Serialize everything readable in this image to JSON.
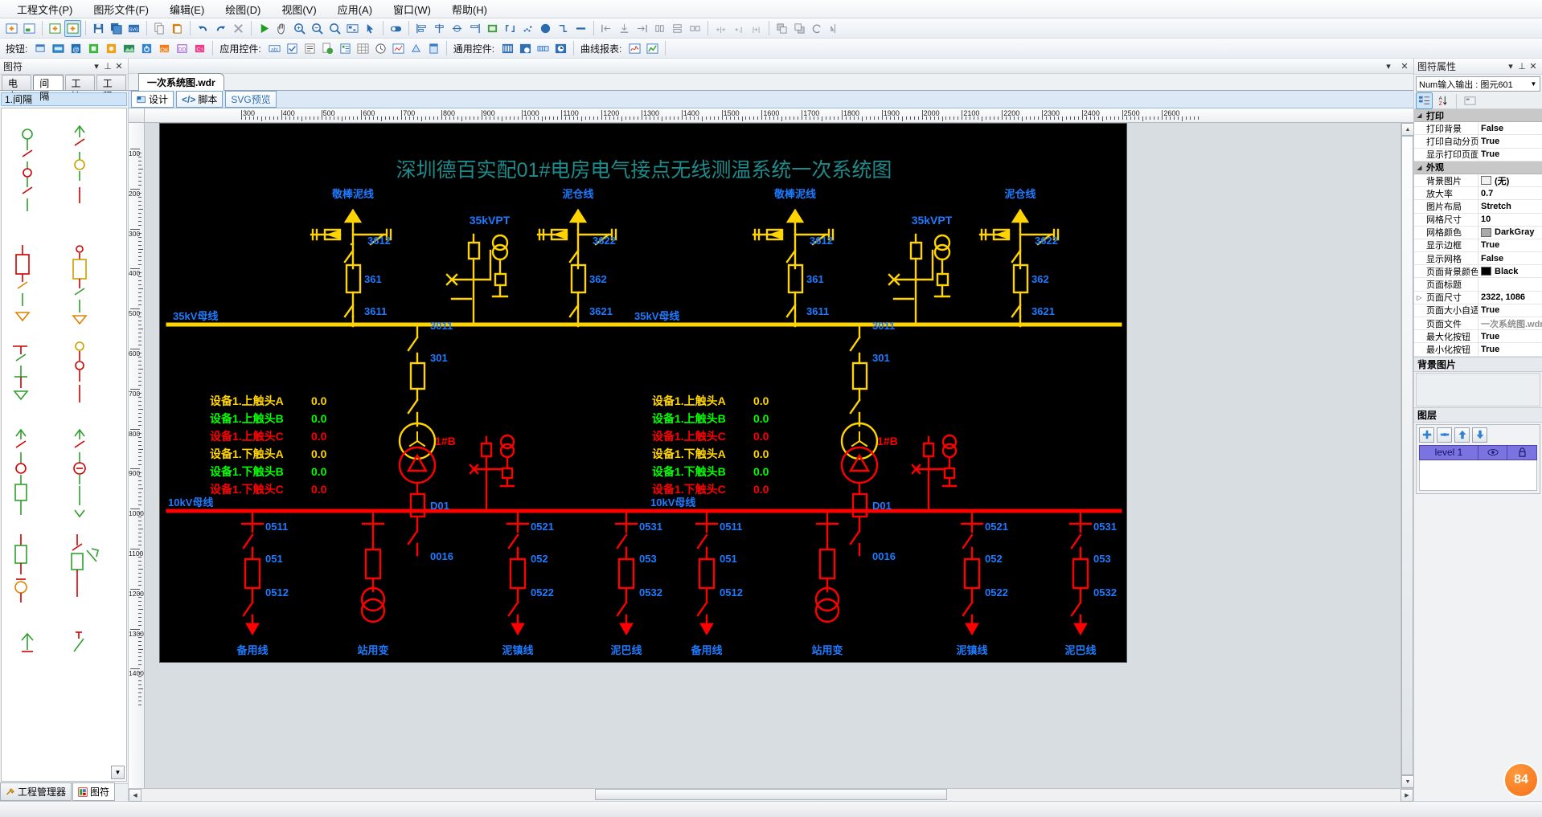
{
  "menu": {
    "items": [
      "工程文件(P)",
      "图形文件(F)",
      "编辑(E)",
      "绘图(D)",
      "视图(V)",
      "应用(A)",
      "窗口(W)",
      "帮助(H)"
    ]
  },
  "toolbar2": {
    "buttons_label": "按钮:",
    "app_controls_label": "应用控件:",
    "common_controls_label": "通用控件:",
    "curve_report_label": "曲线报表:"
  },
  "left_panel": {
    "title": "图符",
    "tabs": [
      "电力",
      "间隔",
      "工控",
      "工程"
    ],
    "active_tab": "间隔",
    "tree_item": "1.间隔",
    "bottom_tabs": [
      "工程管理器",
      "图符"
    ],
    "bottom_active": "图符"
  },
  "document": {
    "tab_title": "一次系统图.wdr",
    "view_tabs": [
      "设计",
      "脚本",
      "SVG预览"
    ],
    "active_view": "设计"
  },
  "rulers": {
    "h_labels": [
      "300",
      "400",
      "500",
      "600",
      "700",
      "800",
      "900",
      "1000",
      "1100",
      "1200",
      "1300",
      "1400",
      "1500",
      "1600",
      "1700",
      "1800",
      "1900",
      "2000",
      "2100",
      "2200",
      "2300",
      "2400",
      "2500",
      "2600"
    ],
    "v_labels": [
      "100",
      "200",
      "300",
      "400",
      "500",
      "600",
      "700",
      "800",
      "900",
      "1000",
      "1100",
      "1200",
      "1300",
      "1400"
    ]
  },
  "right_panel": {
    "title": "图符属性",
    "combo_value": "Num输入输出 : 图元601",
    "groups": [
      {
        "name": "打印",
        "rows": [
          {
            "name": "打印背景",
            "value": "False"
          },
          {
            "name": "打印自动分页",
            "value": "True"
          },
          {
            "name": "显示打印页面",
            "value": "True"
          }
        ]
      },
      {
        "name": "外观",
        "rows": [
          {
            "name": "背景图片",
            "value": "(无)",
            "swatch": "#f0f0f0"
          },
          {
            "name": "放大率",
            "value": "0.7"
          },
          {
            "name": "图片布局",
            "value": "Stretch"
          },
          {
            "name": "网格尺寸",
            "value": "10"
          },
          {
            "name": "网格颜色",
            "value": "DarkGray",
            "swatch": "#a9a9a9"
          },
          {
            "name": "显示边框",
            "value": "True"
          },
          {
            "name": "显示网格",
            "value": "False"
          },
          {
            "name": "页面背景颜色",
            "value": "Black",
            "swatch": "#000000"
          },
          {
            "name": "页面标题",
            "value": ""
          },
          {
            "name": "页面尺寸",
            "value": "2322, 1086",
            "expandable": true
          },
          {
            "name": "页面大小自适应",
            "value": "True"
          },
          {
            "name": "页面文件",
            "value": "一次系统图.wdr",
            "disabled": true
          },
          {
            "name": "最大化按钮",
            "value": "True"
          },
          {
            "name": "最小化按钮",
            "value": "True"
          }
        ]
      }
    ],
    "bgimage_section": "背景图片",
    "layer_section": "图层",
    "layer_row": {
      "name": "level 1",
      "visible_icon": "eye-icon",
      "lock_icon": "lock-icon"
    },
    "badge": "84"
  },
  "diagram": {
    "title": "深圳德百实配01#电房电气接点无线测温系统一次系统图",
    "title_color": "#1f8a8a",
    "colors": {
      "yellow": "#ffd400",
      "red": "#ff0000",
      "blue": "#1e7bff",
      "green": "#00ff00",
      "white": "#ffffff"
    },
    "bus35_label": "35kV母线",
    "bus10_label": "10kV母线",
    "pt_label": "35kVPT",
    "transformer_label": "1#B",
    "top_feeders": [
      "敬棒泥线",
      "泥仓线",
      "敬棒泥线",
      "泥仓线"
    ],
    "bottom_feeders": [
      "备用线",
      "站用变",
      "泥镇线",
      "泥巴线",
      "备用线",
      "站用变",
      "泥镇线",
      "泥巴线"
    ],
    "hv_tags_left": [
      "3612",
      "361",
      "3611",
      "3622",
      "362",
      "3621"
    ],
    "hv_tags_right": [
      "3612",
      "361",
      "3611",
      "3622",
      "362",
      "3621"
    ],
    "tie_tags": [
      "3011",
      "301",
      "D01",
      "0016"
    ],
    "lv_tags": [
      "0511",
      "051",
      "0512",
      "0521",
      "052",
      "0522",
      "0531",
      "053",
      "0532"
    ],
    "measure_rows": [
      {
        "label": "设备1.上触头A",
        "value": "0.0",
        "color": "#ffd400"
      },
      {
        "label": "设备1.上触头B",
        "value": "0.0",
        "color": "#00ff00"
      },
      {
        "label": "设备1.上触头C",
        "value": "0.0",
        "color": "#ff0000"
      },
      {
        "label": "设备1.下触头A",
        "value": "0.0",
        "color": "#ffd400"
      },
      {
        "label": "设备1.下触头B",
        "value": "0.0",
        "color": "#00ff00"
      },
      {
        "label": "设备1.下触头C",
        "value": "0.0",
        "color": "#ff0000"
      }
    ]
  }
}
